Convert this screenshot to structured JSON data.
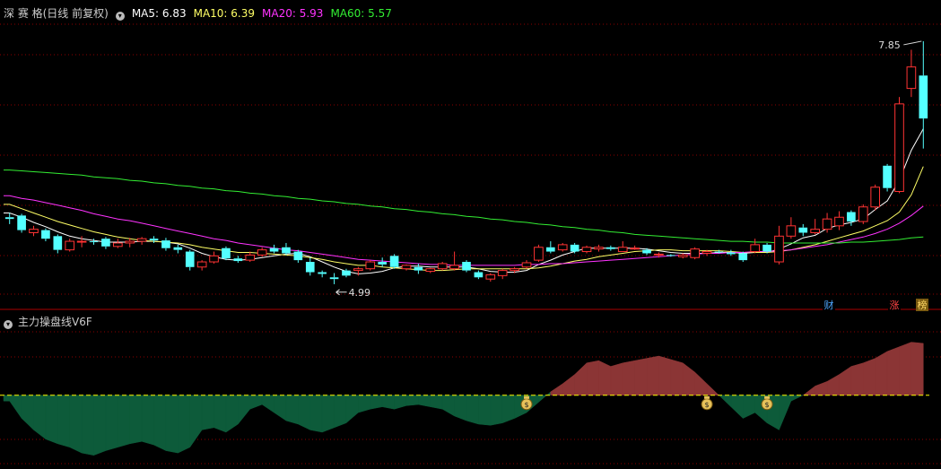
{
  "header": {
    "title": "深 赛 格(日线 前复权)",
    "ma5": {
      "label": "MA5: 6.83",
      "color": "#ffffff"
    },
    "ma10": {
      "label": "MA10: 6.39",
      "color": "#ffff66"
    },
    "ma20": {
      "label": "MA20: 5.93",
      "color": "#ff33ff"
    },
    "ma60": {
      "label": "MA60: 5.57",
      "color": "#33ee33"
    }
  },
  "indicator": {
    "title": "主力操盘线V6F"
  },
  "markers": {
    "cai": "财",
    "zhang": "涨",
    "bang": "榜"
  },
  "colors": {
    "up": "#ff3333",
    "down": "#54ffff",
    "grid": "#8b0000",
    "pos_area": "#8b3535",
    "neg_area": "#0d5b3a",
    "zero_line": "#ffff00"
  },
  "chart_data": [
    {
      "type": "candlestick",
      "title": "深 赛 格(日线 前复权)",
      "ylim": [
        4.8,
        8.1
      ],
      "annotations": [
        {
          "label": "7.85",
          "value": 7.85
        },
        {
          "label": "4.99",
          "value": 4.99
        }
      ],
      "series": [
        {
          "name": "K",
          "ohlc": [
            [
              5.8,
              5.85,
              5.72,
              5.78
            ],
            [
              5.82,
              5.84,
              5.62,
              5.65
            ],
            [
              5.62,
              5.7,
              5.58,
              5.66
            ],
            [
              5.65,
              5.67,
              5.52,
              5.55
            ],
            [
              5.58,
              5.6,
              5.38,
              5.42
            ],
            [
              5.42,
              5.55,
              5.4,
              5.52
            ],
            [
              5.52,
              5.58,
              5.45,
              5.52
            ],
            [
              5.52,
              5.55,
              5.48,
              5.51
            ],
            [
              5.55,
              5.57,
              5.43,
              5.46
            ],
            [
              5.46,
              5.55,
              5.44,
              5.5
            ],
            [
              5.5,
              5.56,
              5.45,
              5.52
            ],
            [
              5.52,
              5.57,
              5.48,
              5.55
            ],
            [
              5.55,
              5.58,
              5.5,
              5.53
            ],
            [
              5.53,
              5.56,
              5.41,
              5.44
            ],
            [
              5.45,
              5.48,
              5.38,
              5.42
            ],
            [
              5.4,
              5.42,
              5.18,
              5.22
            ],
            [
              5.22,
              5.3,
              5.18,
              5.28
            ],
            [
              5.28,
              5.4,
              5.26,
              5.35
            ],
            [
              5.44,
              5.46,
              5.3,
              5.32
            ],
            [
              5.32,
              5.35,
              5.27,
              5.29
            ],
            [
              5.3,
              5.4,
              5.28,
              5.36
            ],
            [
              5.36,
              5.45,
              5.34,
              5.42
            ],
            [
              5.44,
              5.48,
              5.38,
              5.4
            ],
            [
              5.45,
              5.5,
              5.36,
              5.38
            ],
            [
              5.4,
              5.42,
              5.27,
              5.3
            ],
            [
              5.28,
              5.33,
              5.12,
              5.16
            ],
            [
              5.16,
              5.18,
              5.1,
              5.14
            ],
            [
              5.1,
              5.15,
              5.02,
              5.08
            ],
            [
              5.18,
              5.2,
              5.1,
              5.12
            ],
            [
              5.18,
              5.22,
              5.12,
              5.2
            ],
            [
              5.2,
              5.3,
              5.18,
              5.28
            ],
            [
              5.28,
              5.33,
              5.22,
              5.25
            ],
            [
              5.35,
              5.37,
              5.2,
              5.22
            ],
            [
              5.2,
              5.25,
              5.18,
              5.24
            ],
            [
              5.22,
              5.26,
              5.14,
              5.18
            ],
            [
              5.17,
              5.21,
              5.15,
              5.2
            ],
            [
              5.2,
              5.28,
              5.18,
              5.26
            ],
            [
              5.2,
              5.4,
              5.18,
              5.24
            ],
            [
              5.28,
              5.3,
              5.16,
              5.18
            ],
            [
              5.16,
              5.18,
              5.08,
              5.1
            ],
            [
              5.08,
              5.15,
              5.05,
              5.13
            ],
            [
              5.12,
              5.2,
              5.08,
              5.18
            ],
            [
              5.18,
              5.22,
              5.15,
              5.2
            ],
            [
              5.22,
              5.3,
              5.2,
              5.27
            ],
            [
              5.3,
              5.48,
              5.28,
              5.45
            ],
            [
              5.45,
              5.52,
              5.38,
              5.4
            ],
            [
              5.42,
              5.5,
              5.4,
              5.48
            ],
            [
              5.48,
              5.5,
              5.38,
              5.4
            ],
            [
              5.4,
              5.47,
              5.38,
              5.45
            ],
            [
              5.43,
              5.48,
              5.4,
              5.45
            ],
            [
              5.45,
              5.47,
              5.41,
              5.43
            ],
            [
              5.4,
              5.52,
              5.4,
              5.45
            ],
            [
              5.44,
              5.47,
              5.42,
              5.44
            ],
            [
              5.42,
              5.44,
              5.36,
              5.38
            ],
            [
              5.36,
              5.39,
              5.33,
              5.37
            ],
            [
              5.36,
              5.37,
              5.34,
              5.35
            ],
            [
              5.34,
              5.38,
              5.32,
              5.36
            ],
            [
              5.33,
              5.45,
              5.31,
              5.43
            ],
            [
              5.38,
              5.42,
              5.35,
              5.4
            ],
            [
              5.4,
              5.42,
              5.38,
              5.39
            ],
            [
              5.39,
              5.42,
              5.35,
              5.37
            ],
            [
              5.38,
              5.4,
              5.28,
              5.3
            ],
            [
              5.4,
              5.55,
              5.38,
              5.48
            ],
            [
              5.48,
              5.5,
              5.38,
              5.4
            ],
            [
              5.28,
              5.7,
              5.25,
              5.58
            ],
            [
              5.58,
              5.8,
              5.55,
              5.7
            ],
            [
              5.68,
              5.72,
              5.58,
              5.62
            ],
            [
              5.62,
              5.78,
              5.6,
              5.66
            ],
            [
              5.66,
              5.85,
              5.62,
              5.78
            ],
            [
              5.7,
              5.87,
              5.65,
              5.8
            ],
            [
              5.86,
              5.88,
              5.7,
              5.75
            ],
            [
              5.75,
              5.95,
              5.72,
              5.92
            ],
            [
              5.92,
              6.18,
              5.88,
              6.15
            ],
            [
              6.4,
              6.42,
              6.1,
              6.14
            ],
            [
              6.1,
              7.2,
              6.08,
              7.12
            ],
            [
              7.3,
              7.75,
              7.2,
              7.55
            ],
            [
              7.45,
              7.85,
              6.6,
              6.95
            ]
          ]
        },
        {
          "name": "MA5",
          "values": [
            5.85,
            5.8,
            5.74,
            5.69,
            5.63,
            5.58,
            5.55,
            5.53,
            5.51,
            5.51,
            5.51,
            5.52,
            5.52,
            5.51,
            5.49,
            5.44,
            5.38,
            5.34,
            5.31,
            5.3,
            5.31,
            5.33,
            5.35,
            5.37,
            5.38,
            5.34,
            5.28,
            5.22,
            5.17,
            5.14,
            5.15,
            5.17,
            5.21,
            5.23,
            5.23,
            5.22,
            5.22,
            5.22,
            5.22,
            5.2,
            5.17,
            5.16,
            5.16,
            5.18,
            5.25,
            5.3,
            5.36,
            5.4,
            5.44,
            5.44,
            5.44,
            5.44,
            5.44,
            5.43,
            5.41,
            5.39,
            5.38,
            5.38,
            5.38,
            5.39,
            5.39,
            5.38,
            5.39,
            5.39,
            5.43,
            5.49,
            5.56,
            5.59,
            5.67,
            5.71,
            5.74,
            5.78,
            5.89,
            5.99,
            6.23,
            6.58,
            6.83
          ]
        },
        {
          "name": "MA10",
          "values": [
            5.95,
            5.9,
            5.85,
            5.8,
            5.75,
            5.71,
            5.67,
            5.63,
            5.6,
            5.57,
            5.55,
            5.53,
            5.52,
            5.51,
            5.5,
            5.48,
            5.45,
            5.43,
            5.41,
            5.39,
            5.39,
            5.38,
            5.37,
            5.36,
            5.35,
            5.33,
            5.31,
            5.28,
            5.26,
            5.24,
            5.24,
            5.22,
            5.21,
            5.2,
            5.19,
            5.18,
            5.18,
            5.19,
            5.2,
            5.2,
            5.2,
            5.2,
            5.2,
            5.2,
            5.21,
            5.23,
            5.26,
            5.29,
            5.31,
            5.34,
            5.36,
            5.38,
            5.4,
            5.41,
            5.42,
            5.42,
            5.41,
            5.41,
            5.41,
            5.41,
            5.4,
            5.39,
            5.39,
            5.39,
            5.4,
            5.42,
            5.45,
            5.48,
            5.52,
            5.56,
            5.6,
            5.64,
            5.7,
            5.76,
            5.86,
            6.06,
            6.39
          ]
        },
        {
          "name": "MA20",
          "values": [
            6.05,
            6.02,
            6.0,
            5.97,
            5.94,
            5.91,
            5.88,
            5.84,
            5.81,
            5.78,
            5.76,
            5.73,
            5.7,
            5.67,
            5.64,
            5.61,
            5.58,
            5.55,
            5.53,
            5.5,
            5.48,
            5.46,
            5.44,
            5.42,
            5.41,
            5.39,
            5.37,
            5.35,
            5.33,
            5.31,
            5.3,
            5.29,
            5.28,
            5.27,
            5.26,
            5.25,
            5.25,
            5.24,
            5.24,
            5.24,
            5.24,
            5.24,
            5.24,
            5.25,
            5.25,
            5.26,
            5.26,
            5.27,
            5.28,
            5.29,
            5.3,
            5.31,
            5.32,
            5.33,
            5.34,
            5.35,
            5.36,
            5.37,
            5.38,
            5.38,
            5.39,
            5.39,
            5.4,
            5.4,
            5.41,
            5.42,
            5.44,
            5.46,
            5.48,
            5.51,
            5.54,
            5.57,
            5.61,
            5.66,
            5.73,
            5.82,
            5.93
          ]
        },
        {
          "name": "MA60",
          "values": [
            6.35,
            6.34,
            6.33,
            6.32,
            6.31,
            6.3,
            6.29,
            6.27,
            6.26,
            6.25,
            6.23,
            6.22,
            6.2,
            6.19,
            6.17,
            6.16,
            6.14,
            6.13,
            6.11,
            6.1,
            6.08,
            6.07,
            6.05,
            6.04,
            6.02,
            6.01,
            5.99,
            5.98,
            5.96,
            5.95,
            5.93,
            5.92,
            5.9,
            5.89,
            5.87,
            5.86,
            5.84,
            5.83,
            5.81,
            5.8,
            5.78,
            5.77,
            5.75,
            5.74,
            5.72,
            5.71,
            5.69,
            5.68,
            5.66,
            5.65,
            5.63,
            5.62,
            5.6,
            5.59,
            5.58,
            5.57,
            5.56,
            5.55,
            5.54,
            5.53,
            5.52,
            5.52,
            5.51,
            5.51,
            5.5,
            5.5,
            5.5,
            5.5,
            5.5,
            5.5,
            5.51,
            5.51,
            5.52,
            5.53,
            5.54,
            5.56,
            5.57
          ]
        }
      ]
    },
    {
      "type": "area",
      "title": "主力操盘线V6F",
      "ylim": [
        -60,
        55
      ],
      "series": [
        {
          "name": "主力操盘线V6F",
          "values": [
            -5,
            -20,
            -30,
            -38,
            -42,
            -45,
            -50,
            -52,
            -48,
            -45,
            -42,
            -40,
            -43,
            -48,
            -50,
            -45,
            -30,
            -28,
            -32,
            -25,
            -12,
            -8,
            -15,
            -22,
            -25,
            -30,
            -32,
            -28,
            -24,
            -15,
            -12,
            -10,
            -12,
            -9,
            -8,
            -10,
            -12,
            -18,
            -22,
            -25,
            -26,
            -24,
            -20,
            -15,
            -6,
            3,
            10,
            18,
            28,
            30,
            25,
            28,
            30,
            32,
            34,
            31,
            28,
            20,
            10,
            0,
            -10,
            -20,
            -15,
            -24,
            -30,
            -5,
            0,
            8,
            12,
            18,
            25,
            28,
            32,
            38,
            42,
            46,
            45
          ]
        }
      ],
      "signals": [
        43,
        58,
        63
      ]
    }
  ]
}
